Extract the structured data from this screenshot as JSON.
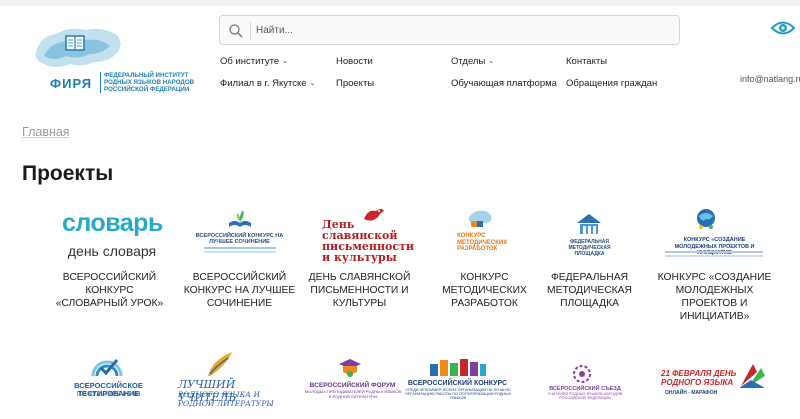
{
  "header": {
    "logo_word": "ФИРЯ",
    "logo_caption": "Федеральный институт родных языков народов Российской Федерации",
    "search_placeholder": "Найти...",
    "email": "info@natlang.ru"
  },
  "nav": {
    "col1": [
      "Об институте",
      "Филиал в г. Якутске"
    ],
    "col2": [
      "Новости",
      "Проекты"
    ],
    "col3": [
      "Отделы",
      "Обучающая платформа"
    ],
    "col4": [
      "Контакты",
      "Обращения граждан"
    ]
  },
  "breadcrumb": "Главная",
  "page_title": "Проекты",
  "projects": [
    {
      "label": "Всероссийский конкурс «Словарный урок»",
      "logo_title": "словарь",
      "logo_sub": "день словаря"
    },
    {
      "label": "Всероссийский конкурс на лучшее сочинение",
      "logo_title": "ВСЕРОССИЙСКИЙ КОНКУРС НА ЛУЧШЕЕ СОЧИНЕНИЕ"
    },
    {
      "label": "День славянской письменности и культуры",
      "logo_title": "День славянской письменности и культуры"
    },
    {
      "label": "Конкурс методических разработок",
      "logo_title": "КОНКУРС МЕТОДИЧЕСКИХ РАЗРАБОТОК"
    },
    {
      "label": "Федеральная методическая площадка",
      "logo_title": "ФЕДЕРАЛЬНАЯ МЕТОДИЧЕСКАЯ ПЛОЩАДКА"
    },
    {
      "label": "Конкурс «Создание молодежных проектов и инициатив»",
      "logo_title": "КОНКУРС «СОЗДАНИЕ МОЛОДЕЖНЫХ ПРОЕКТОВ И ИНИЦИАТИВ"
    }
  ],
  "projects_row2": [
    {
      "logo_title": "ВСЕРОССИЙСКОЕ ТЕСТИРОВАНИЕ",
      "logo_sub": "ПО КУЛЬТУРЕ РЕЧИ"
    },
    {
      "logo_title": "ЛУЧШИЙ УЧИТЕЛЬ",
      "logo_sub": "РОДНОГО ЯЗЫКА И РОДНОЙ ЛИТЕРАТУРЫ"
    },
    {
      "logo_title": "ВСЕРОССИЙСКИЙ ФОРУМ",
      "logo_sub": "МОЛОДЫХ ПРЕПОДАВАТЕЛЕЙ РОДНЫХ ЯЗЫКОВ И РОДНОЙ ЛИТЕРАТУРЫ"
    },
    {
      "logo_title": "ВСЕРОССИЙСКИЙ КОНКУРС",
      "logo_sub": "СРЕДИ НЕКОММЕРЧЕСКИХ ОРГАНИЗАЦИЙ НА ЛУЧШУЮ ОРГАНИЗАЦИЮ РАБОТЫ ПО ПОПУЛЯРИЗАЦИИ РОДНЫХ ЯЗЫКОВ"
    },
    {
      "logo_title": "ВСЕРОССИЙСКИЙ СЪЕЗД",
      "logo_sub": "УЧИТЕЛЕЙ РОДНЫХ ЯЗЫКОВ НАРОДОВ РОССИЙСКОЙ ФЕДЕРАЦИИ"
    },
    {
      "logo_title": "21 ФЕВРАЛЯ ДЕНЬ РОДНОГО ЯЗЫКА",
      "logo_sub": "ОНЛАЙН - МАРАФОН"
    }
  ],
  "colors": {
    "brand": "#1f7fae",
    "accent_red": "#c8262a",
    "accent_orange": "#f08a1c"
  }
}
